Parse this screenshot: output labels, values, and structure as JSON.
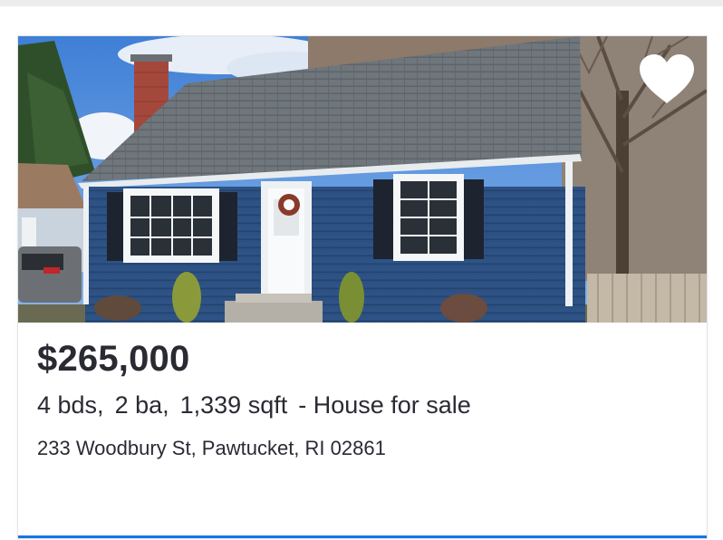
{
  "listing": {
    "price": "$265,000",
    "beds": "4 bds,",
    "baths": "2 ba,",
    "sqft": "1,339 sqft",
    "status": "- House for sale",
    "address": "233 Woodbury St, Pawtucket, RI 02861",
    "photo": "house-exterior-photo",
    "favorite_icon": "heart-icon"
  },
  "colors": {
    "accent": "#1277e1",
    "text": "#2a2a33",
    "house_siding": "#2f5386",
    "roof": "#6d7378"
  }
}
